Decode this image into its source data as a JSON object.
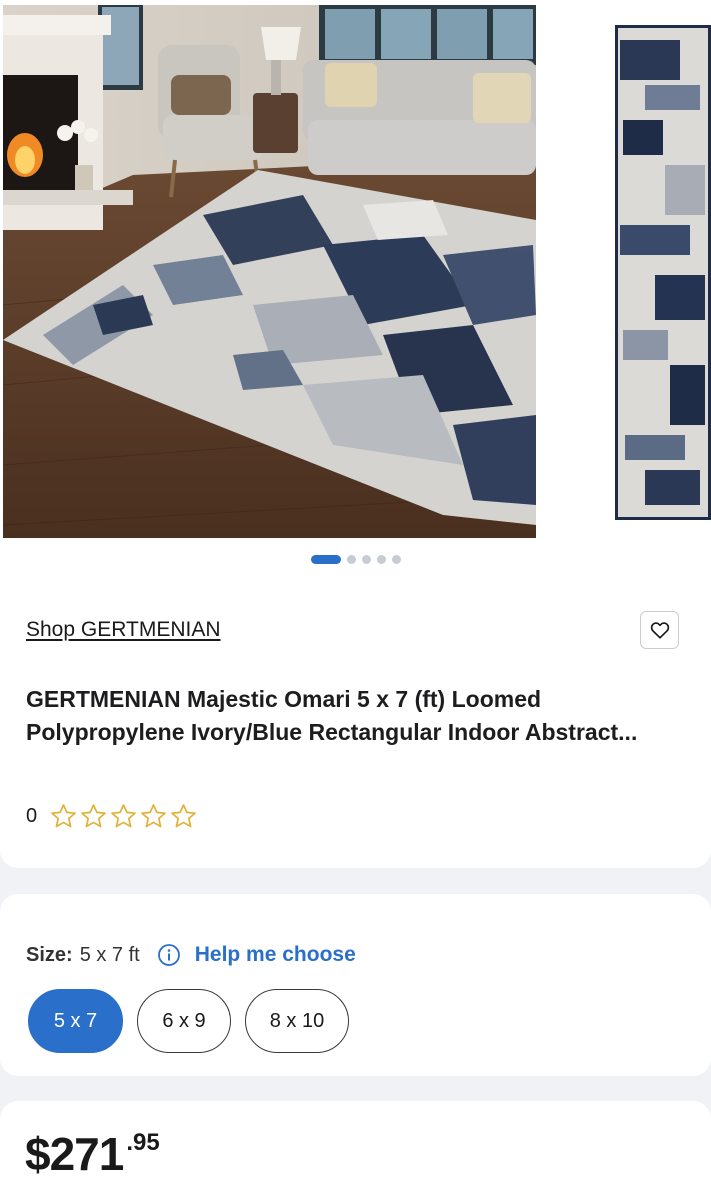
{
  "carousel": {
    "slide_count": 5,
    "active_index": 0,
    "alt": "GERTMENIAN Majestic Omari rug"
  },
  "product": {
    "shop_link": "Shop GERTMENIAN",
    "title": "GERTMENIAN Majestic Omari 5 x 7 (ft) Loomed Polypropylene Ivory/Blue Rectangular Indoor Abstract...",
    "rating_count": "0",
    "rating_value": 0,
    "rating_max": 5,
    "favorite_icon": "heart-icon"
  },
  "size": {
    "label": "Size:",
    "value": "5 x 7 ft",
    "info_icon": "info-icon",
    "help_link": "Help me choose",
    "options": [
      {
        "label": "5 x 7",
        "selected": true
      },
      {
        "label": "6 x 9",
        "selected": false
      },
      {
        "label": "8 x 10",
        "selected": false
      }
    ]
  },
  "price": {
    "main": "$271",
    "cents": ".95"
  },
  "colors": {
    "accent": "#2a6fc9",
    "star": "#e0b23a",
    "card_bg": "#ffffff",
    "page_bg": "#f1f2f6"
  }
}
